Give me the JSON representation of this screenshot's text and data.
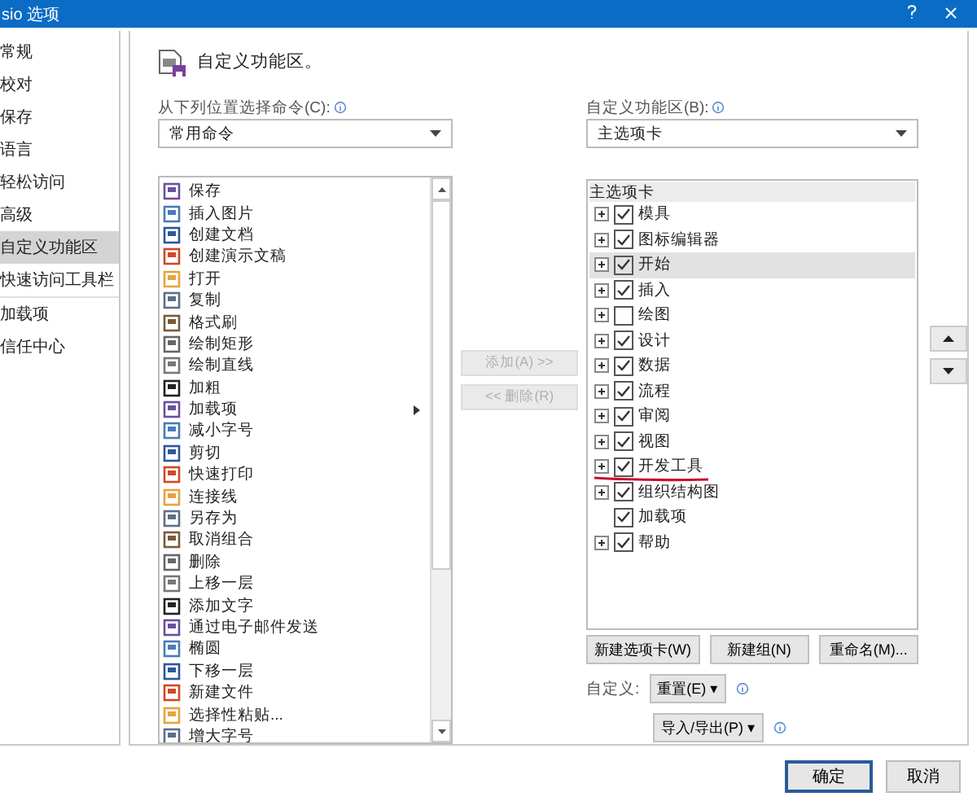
{
  "window": {
    "title": "sio 选项"
  },
  "title_buttons": [
    {
      "kind": "help"
    },
    {
      "kind": "close"
    }
  ],
  "nav": [
    {
      "label": "常规",
      "selected": false
    },
    {
      "label": "校对",
      "selected": false
    },
    {
      "label": "保存",
      "selected": false
    },
    {
      "label": "语言",
      "selected": false
    },
    {
      "label": "轻松访问",
      "selected": false
    },
    {
      "label": "高级",
      "selected": false
    },
    {
      "label": "自定义功能区",
      "selected": true
    },
    {
      "label": "快速访问工具栏",
      "selected": false
    },
    {
      "label": "加载项",
      "selected": false
    },
    {
      "label": "信任中心",
      "selected": false
    }
  ],
  "heading": "自定义功能区。",
  "commands_source": {
    "label": "从下列位置选择命令(C):",
    "value": "常用命令"
  },
  "commands": [
    {
      "label": "保存",
      "submenu": false
    },
    {
      "label": "插入图片",
      "submenu": false
    },
    {
      "label": "创建文档",
      "submenu": false
    },
    {
      "label": "创建演示文稿",
      "submenu": false
    },
    {
      "label": "打开",
      "submenu": false
    },
    {
      "label": "复制",
      "submenu": false
    },
    {
      "label": "格式刷",
      "submenu": false
    },
    {
      "label": "绘制矩形",
      "submenu": false
    },
    {
      "label": "绘制直线",
      "submenu": false
    },
    {
      "label": "加粗",
      "submenu": false
    },
    {
      "label": "加载项",
      "submenu": true
    },
    {
      "label": "减小字号",
      "submenu": false
    },
    {
      "label": "剪切",
      "submenu": false
    },
    {
      "label": "快速打印",
      "submenu": false
    },
    {
      "label": "连接线",
      "submenu": false
    },
    {
      "label": "另存为",
      "submenu": false
    },
    {
      "label": "取消组合",
      "submenu": false
    },
    {
      "label": "删除",
      "submenu": false
    },
    {
      "label": "上移一层",
      "submenu": false
    },
    {
      "label": "添加文字",
      "submenu": false
    },
    {
      "label": "通过电子邮件发送",
      "submenu": false
    },
    {
      "label": "椭圆",
      "submenu": false
    },
    {
      "label": "下移一层",
      "submenu": false
    },
    {
      "label": "新建文件",
      "submenu": false
    },
    {
      "label": "选择性粘贴...",
      "submenu": false
    },
    {
      "label": "增大字号",
      "submenu": false
    }
  ],
  "move_buttons": [
    {
      "label": "添加(A) >>",
      "disabled": true
    },
    {
      "label": "<< 删除(R)",
      "disabled": true
    }
  ],
  "ribbon_target": {
    "label": "自定义功能区(B):",
    "value": "主选项卡"
  },
  "tree": {
    "header": "主选项卡",
    "items": [
      {
        "label": "模具",
        "checked": true,
        "expandable": true,
        "selected": false
      },
      {
        "label": "图标编辑器",
        "checked": true,
        "expandable": true,
        "selected": false
      },
      {
        "label": "开始",
        "checked": true,
        "expandable": true,
        "selected": true
      },
      {
        "label": "插入",
        "checked": true,
        "expandable": true,
        "selected": false
      },
      {
        "label": "绘图",
        "checked": false,
        "expandable": true,
        "selected": false
      },
      {
        "label": "设计",
        "checked": true,
        "expandable": true,
        "selected": false
      },
      {
        "label": "数据",
        "checked": true,
        "expandable": true,
        "selected": false
      },
      {
        "label": "流程",
        "checked": true,
        "expandable": true,
        "selected": false
      },
      {
        "label": "审阅",
        "checked": true,
        "expandable": true,
        "selected": false
      },
      {
        "label": "视图",
        "checked": true,
        "expandable": true,
        "selected": false
      },
      {
        "label": "开发工具",
        "checked": true,
        "expandable": true,
        "selected": false,
        "underlined": true
      },
      {
        "label": "组织结构图",
        "checked": true,
        "expandable": true,
        "selected": false
      },
      {
        "label": "加载项",
        "checked": true,
        "expandable": false,
        "selected": false
      },
      {
        "label": "帮助",
        "checked": true,
        "expandable": true,
        "selected": false
      }
    ]
  },
  "order_buttons": [
    {
      "kind": "up"
    },
    {
      "kind": "down"
    }
  ],
  "tree_buttons": [
    "新建选项卡(W)",
    "新建组(N)",
    "重命名(M)..."
  ],
  "customize": {
    "label": "自定义:",
    "reset": "重置(E) ▾",
    "import_export": "导入/导出(P) ▾"
  },
  "footer_buttons": [
    {
      "label": "确定",
      "default": true
    },
    {
      "label": "取消",
      "default": false
    }
  ]
}
